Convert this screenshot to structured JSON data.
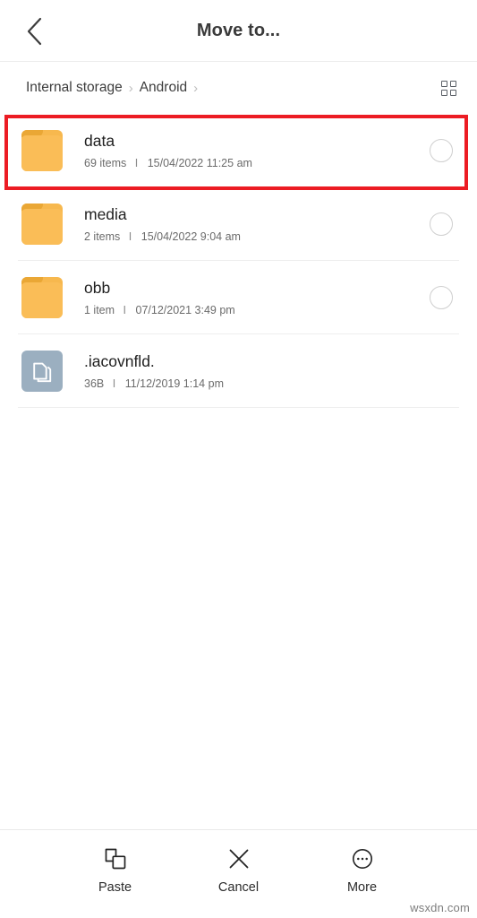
{
  "header": {
    "title": "Move to...",
    "back_icon": "chevron-left-icon"
  },
  "breadcrumb": {
    "items": [
      {
        "label": "Internal storage"
      },
      {
        "label": "Android"
      }
    ],
    "separator": "›",
    "view_toggle_icon": "grid-view-icon"
  },
  "file_list": {
    "rows": [
      {
        "name": "data",
        "icon": "folder-icon",
        "count": "69 items",
        "date": "15/04/2022 11:25 am",
        "separator": "I",
        "selector": "radio-circle",
        "highlighted": true
      },
      {
        "name": "media",
        "icon": "folder-icon",
        "count": "2 items",
        "date": "15/04/2022 9:04 am",
        "separator": "I",
        "selector": "radio-circle",
        "highlighted": false
      },
      {
        "name": "obb",
        "icon": "folder-icon",
        "count": "1 item",
        "date": "07/12/2021 3:49 pm",
        "separator": "I",
        "selector": "radio-circle",
        "highlighted": false
      },
      {
        "name": ".iacovnfld.",
        "icon": "file-document-icon",
        "count": "36B",
        "date": "11/12/2019 1:14 pm",
        "separator": "I",
        "selector": "none",
        "highlighted": false
      }
    ]
  },
  "toolbar": {
    "items": [
      {
        "label": "Paste",
        "icon": "paste-icon"
      },
      {
        "label": "Cancel",
        "icon": "close-x-icon"
      },
      {
        "label": "More",
        "icon": "more-circle-icon"
      }
    ]
  },
  "watermark": {
    "text": "wsxdn.com"
  },
  "colors": {
    "highlight": "#ec1c24",
    "folder": "#f7b84e",
    "file_tile": "#9bafc0",
    "title": "#3a3a3a",
    "divider": "#eeeeee"
  }
}
